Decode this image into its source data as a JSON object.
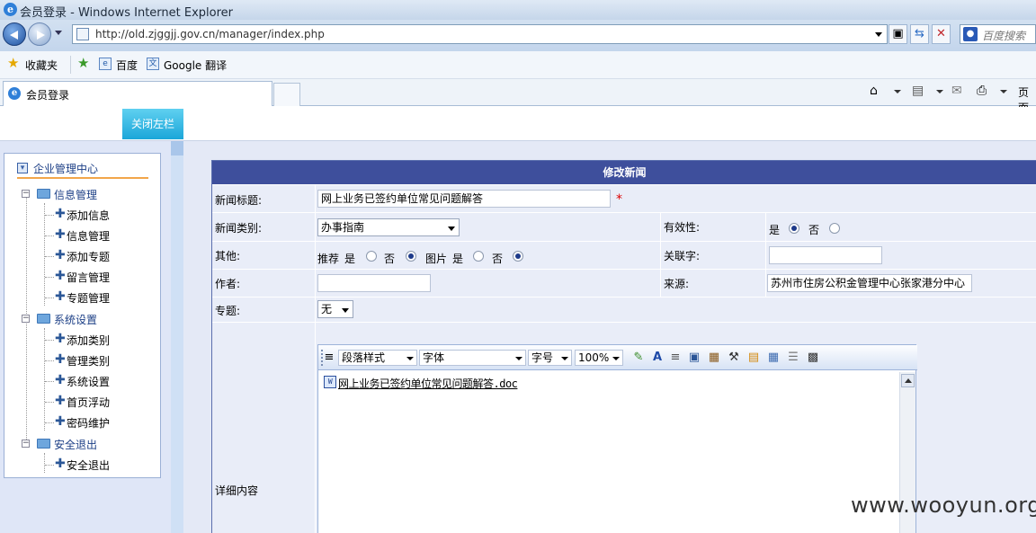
{
  "window": {
    "title": "会员登录 - Windows Internet Explorer"
  },
  "address_bar": {
    "url": "http://old.zjggjj.gov.cn/manager/index.php"
  },
  "search": {
    "placeholder": "百度搜索"
  },
  "favorites_bar": {
    "favorites_label": "收藏夹",
    "links": [
      "百度",
      "Google 翻译"
    ]
  },
  "tabs": [
    {
      "label": "会员登录"
    }
  ],
  "command_bar": {
    "page_label": "页面"
  },
  "page": {
    "close_left_button": "关闭左栏",
    "sidebar": {
      "header": "企业管理中心",
      "groups": [
        {
          "label": "信息管理",
          "items": [
            "添加信息",
            "信息管理",
            "添加专题",
            "留言管理",
            "专题管理"
          ]
        },
        {
          "label": "系统设置",
          "items": [
            "添加类别",
            "管理类别",
            "系统设置",
            "首页浮动",
            "密码维护"
          ]
        },
        {
          "label": "安全退出",
          "items": [
            "安全退出"
          ]
        }
      ]
    },
    "form": {
      "heading": "修改新闻",
      "title_label": "新闻标题:",
      "title_value": "网上业务已签约单位常见问题解答",
      "required_mark": "*",
      "category_label": "新闻类别:",
      "category_value": "办事指南",
      "validity_label": "有效性:",
      "validity_yes": "是",
      "validity_no": "否",
      "validity_selected": "是",
      "other_label": "其他:",
      "recommend_label": "推荐",
      "recommend_yes": "是",
      "recommend_no": "否",
      "recommend_selected": "否",
      "picture_label": "图片",
      "picture_yes": "是",
      "picture_no": "否",
      "picture_selected": "否",
      "keyword_label": "关联字:",
      "keyword_value": "",
      "author_label": "作者:",
      "author_value": "",
      "source_label": "来源:",
      "source_value": "苏州市住房公积金管理中心张家港分中心",
      "topic_label": "专题:",
      "topic_value": "无",
      "content_label": "详细内容",
      "editor": {
        "paragraph_style": "段落样式",
        "font": "字体",
        "font_size": "字号",
        "zoom": "100%",
        "content_link": "网上业务已签约单位常见问题解答.doc"
      }
    }
  },
  "watermark": "www.wooyun.org"
}
